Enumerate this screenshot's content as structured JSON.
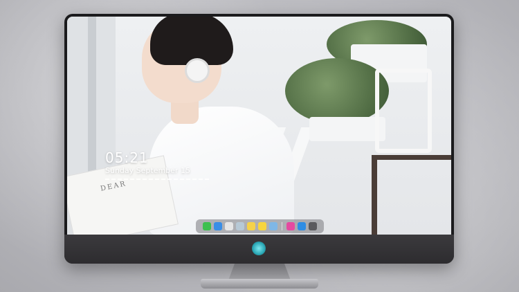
{
  "lockscreen": {
    "time": "05:21",
    "date": "Sunday September 15",
    "book_title": "DEAR"
  },
  "dock": {
    "icons": [
      {
        "name": "messages-icon",
        "color": "#3dc04f"
      },
      {
        "name": "finder-icon",
        "color": "#3a8ee6"
      },
      {
        "name": "safari-icon",
        "color": "#e6e6e6"
      },
      {
        "name": "preview-icon",
        "color": "#b7c9d6"
      },
      {
        "name": "photos-icon",
        "color": "#f5d24a"
      },
      {
        "name": "notes-icon",
        "color": "#f7d53e"
      },
      {
        "name": "launchpad-icon",
        "color": "#7fb7e6"
      },
      {
        "name": "music-icon",
        "color": "#e54aa0"
      },
      {
        "name": "appstore-icon",
        "color": "#2f8de4"
      },
      {
        "name": "camera-icon",
        "color": "#5a5a5e"
      }
    ]
  },
  "monitor": {
    "logo": "chin-logo-icon"
  }
}
